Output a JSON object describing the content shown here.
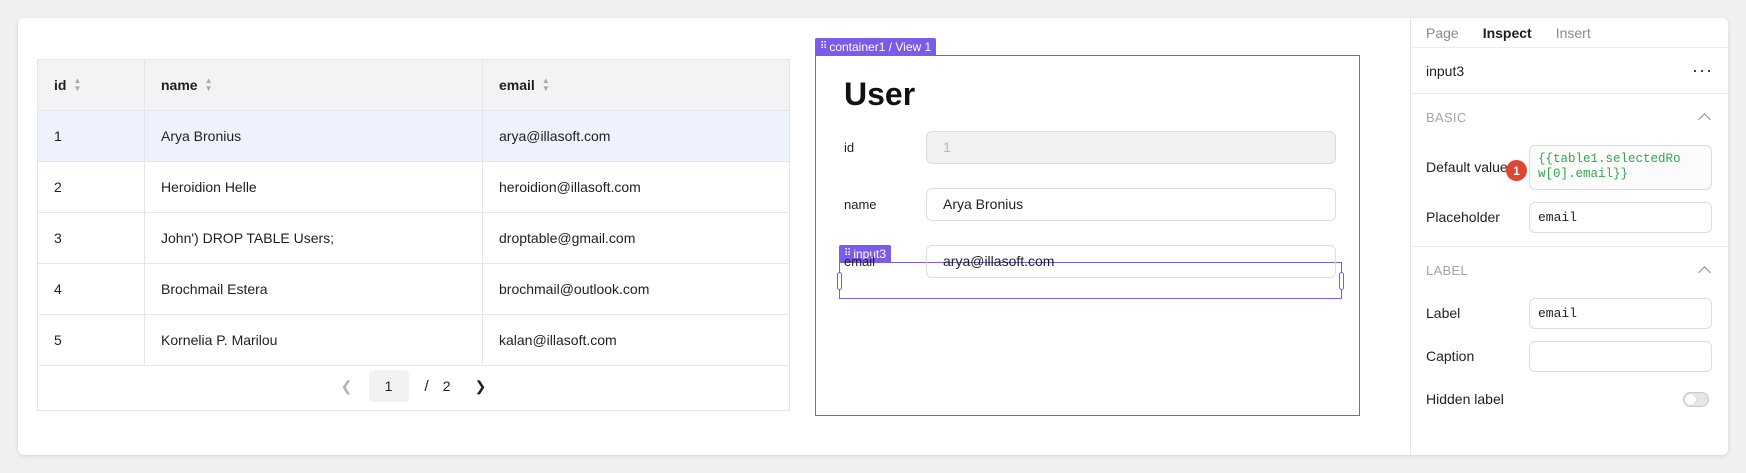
{
  "table": {
    "columns": [
      "id",
      "name",
      "email"
    ],
    "rows": [
      {
        "id": "1",
        "name": "Arya Bronius",
        "email": "arya@illasoft.com"
      },
      {
        "id": "2",
        "name": "Heroidion Helle",
        "email": "heroidion@illasoft.com"
      },
      {
        "id": "3",
        "name": "John') DROP TABLE Users;",
        "email": "droptable@gmail.com"
      },
      {
        "id": "4",
        "name": "Brochmail Estera",
        "email": "brochmail@outlook.com"
      },
      {
        "id": "5",
        "name": "Kornelia P. Marilou",
        "email": "kalan@illasoft.com"
      }
    ],
    "pagination": {
      "current": "1",
      "separator": "/",
      "total": "2"
    }
  },
  "container": {
    "tag": "container1 / View 1",
    "title": "User",
    "fields": [
      {
        "label": "id",
        "value": "1"
      },
      {
        "label": "name",
        "value": "Arya Bronius"
      },
      {
        "label": "email",
        "value": "arya@illasoft.com"
      }
    ],
    "selected_tag": "input3"
  },
  "inspector": {
    "tabs": [
      "Page",
      "Inspect",
      "Insert"
    ],
    "component": "input3",
    "more": "···",
    "basic": {
      "title": "BASIC",
      "default_value_label": "Default value",
      "default_value": "{{table1.selectedRo\nw[0].email}}",
      "badge": "1",
      "placeholder_label": "Placeholder",
      "placeholder_value": "email"
    },
    "label_section": {
      "title": "LABEL",
      "label_label": "Label",
      "label_value": "email",
      "caption_label": "Caption",
      "caption_value": "",
      "hidden_label": "Hidden label"
    }
  },
  "colors": {
    "accent": "#7a5ce8",
    "badge": "#e0452f",
    "code": "#2fa84f",
    "selected_row": "#edf2fd"
  }
}
